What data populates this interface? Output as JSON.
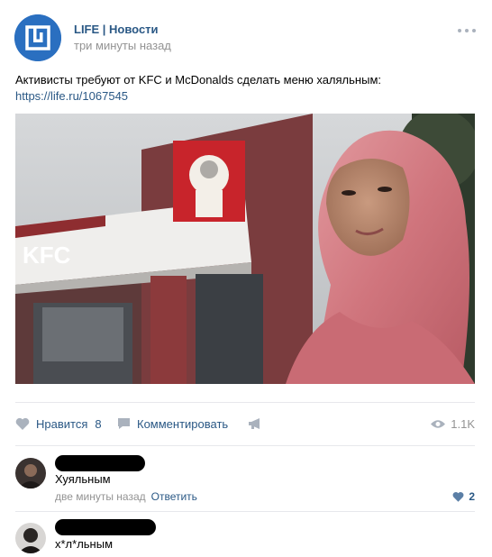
{
  "post": {
    "author": "LIFE | Новости",
    "time": "три минуты назад",
    "text": "Активисты требуют от KFC и McDonalds сделать меню халяльным:",
    "link": "https://life.ru/1067545",
    "photo_sign": "KFC"
  },
  "actions": {
    "like_label": "Нравится",
    "like_count": "8",
    "comment_label": "Комментировать",
    "views": "1.1K"
  },
  "comments": [
    {
      "text": "Хуяльным",
      "time": "две минуты назад",
      "reply": "Ответить",
      "likes": "2"
    },
    {
      "text": "х*л*льным"
    }
  ],
  "colors": {
    "link": "#2a5885",
    "muted": "#939393",
    "divider": "#e7e8ec",
    "brand": "#2a6fc0"
  }
}
